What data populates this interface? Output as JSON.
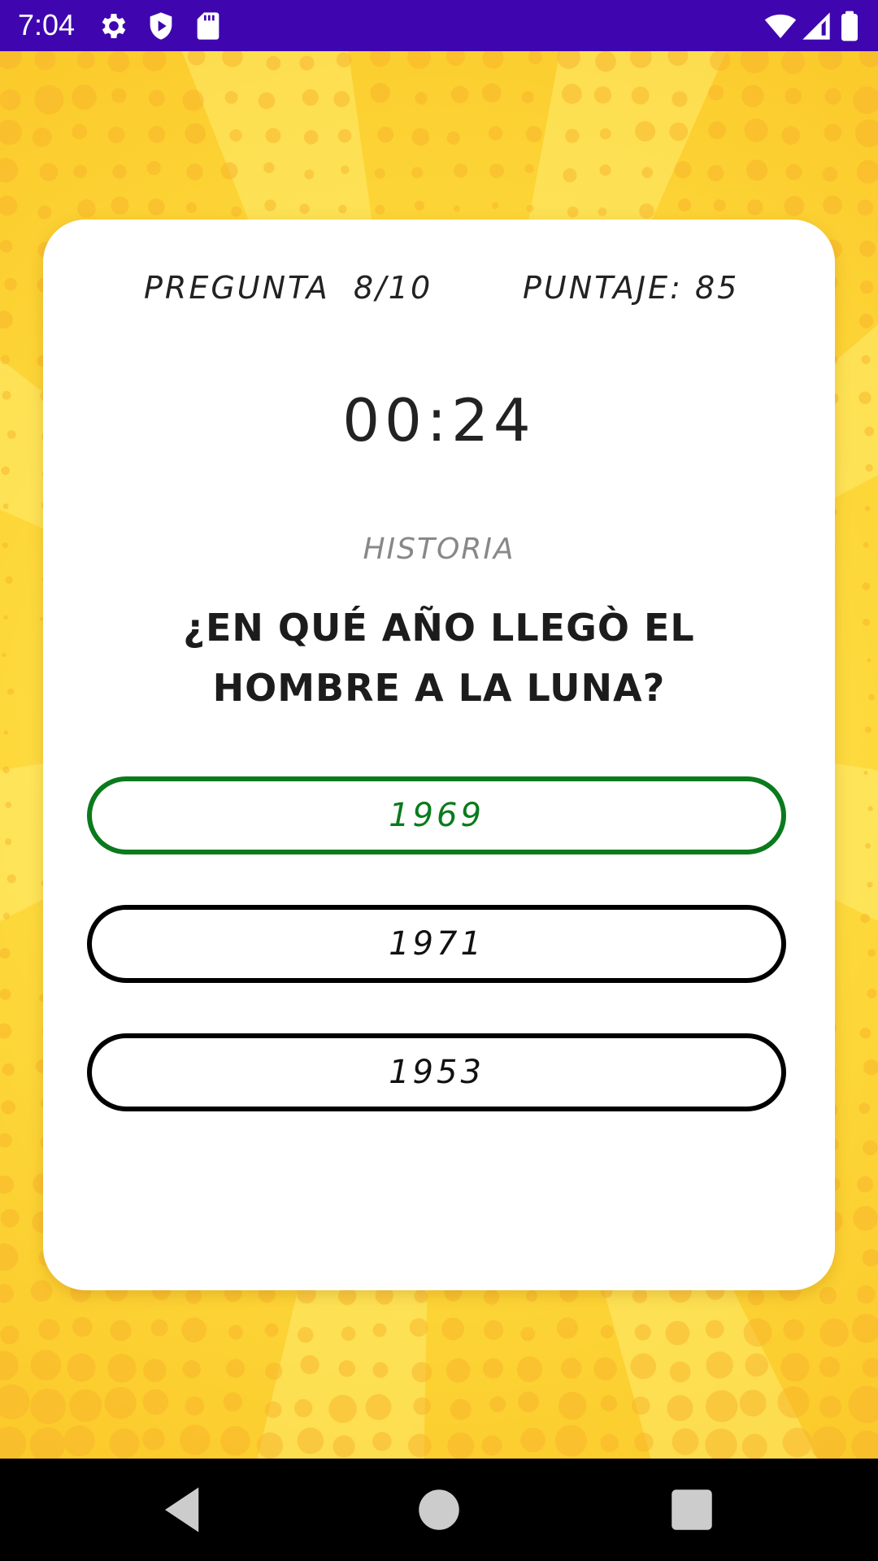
{
  "status_bar": {
    "time": "7:04",
    "background_color": "#3f06b0",
    "icons": [
      "gear-icon",
      "play-protect-icon",
      "sd-card-icon",
      "wifi-icon",
      "signal-icon",
      "battery-icon"
    ]
  },
  "quiz": {
    "question_label": "PREGUNTA",
    "question_progress": "8/10",
    "score_text": "PUNTAJE: 85",
    "timer": "00:24",
    "category": "HISTORIA",
    "question": "¿EN QUÉ AÑO LLEGÒ EL HOMBRE A LA LUNA?",
    "answers": [
      {
        "label": "1969",
        "state": "correct",
        "color": "#0a7a1d"
      },
      {
        "label": "1971",
        "state": "default",
        "color": "#000000"
      },
      {
        "label": "1953",
        "state": "default",
        "color": "#000000"
      }
    ]
  },
  "theme": {
    "background_color": "#fde14a",
    "card_color": "#ffffff"
  },
  "nav_bar": {
    "icons": [
      "back-icon",
      "home-icon",
      "recents-icon"
    ]
  }
}
